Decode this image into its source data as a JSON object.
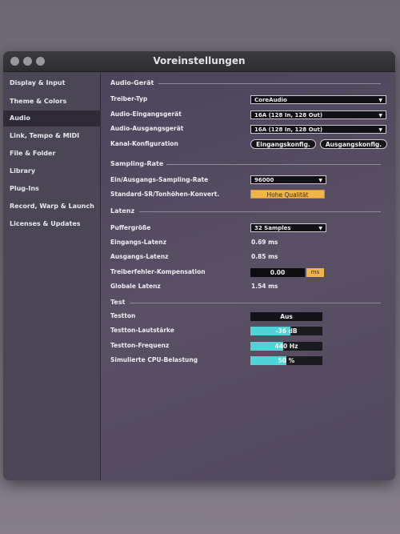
{
  "window": {
    "title": "Voreinstellungen"
  },
  "sidebar": {
    "items": [
      {
        "label": "Display & Input"
      },
      {
        "label": "Theme & Colors"
      },
      {
        "label": "Audio",
        "active": true
      },
      {
        "label": "Link, Tempo & MIDI"
      },
      {
        "label": "File & Folder"
      },
      {
        "label": "Library"
      },
      {
        "label": "Plug-Ins"
      },
      {
        "label": "Record, Warp & Launch"
      },
      {
        "label": "Licenses & Updates"
      }
    ]
  },
  "audio_device": {
    "section": "Audio-Gerät",
    "driver_label": "Treiber-Typ",
    "driver_value": "CoreAudio",
    "input_label": "Audio-Eingangsgerät",
    "input_value": "16A (128 In, 128 Out)",
    "output_label": "Audio-Ausgangsgerät",
    "output_value": "16A (128 In, 128 Out)",
    "channel_label": "Kanal-Konfiguration",
    "input_config_btn": "Eingangskonfig.",
    "output_config_btn": "Ausgangskonfig."
  },
  "sampling": {
    "section": "Sampling-Rate",
    "rate_label": "Ein/Ausgangs-Sampling-Rate",
    "rate_value": "96000",
    "convert_label": "Standard-SR/Tonhöhen-Konvert.",
    "convert_value": "Hohe Qualität"
  },
  "latency": {
    "section": "Latenz",
    "buffer_label": "Puffergröße",
    "buffer_value": "32 Samples",
    "input_latency_label": "Eingangs-Latenz",
    "input_latency_value": "0.69 ms",
    "output_latency_label": "Ausgangs-Latenz",
    "output_latency_value": "0.85 ms",
    "driver_comp_label": "Treiberfehler-Kompensation",
    "driver_comp_value": "0.00",
    "driver_comp_unit": "ms",
    "total_label": "Globale Latenz",
    "total_value": "1.54 ms"
  },
  "test": {
    "section": "Test",
    "tone_label": "Testton",
    "tone_value": "Aus",
    "volume_label": "Testton-Lautstärke",
    "volume_value": "-36 dB",
    "volume_fill_percent": 55,
    "freq_label": "Testton-Frequenz",
    "freq_value": "440 Hz",
    "freq_fill_percent": 45,
    "cpu_label": "Simulierte CPU-Belastung",
    "cpu_value": "50 %",
    "cpu_fill_percent": 50
  },
  "colors": {
    "accent_yellow": "#f1b44a",
    "slider_cyan": "#4fd3d5"
  }
}
